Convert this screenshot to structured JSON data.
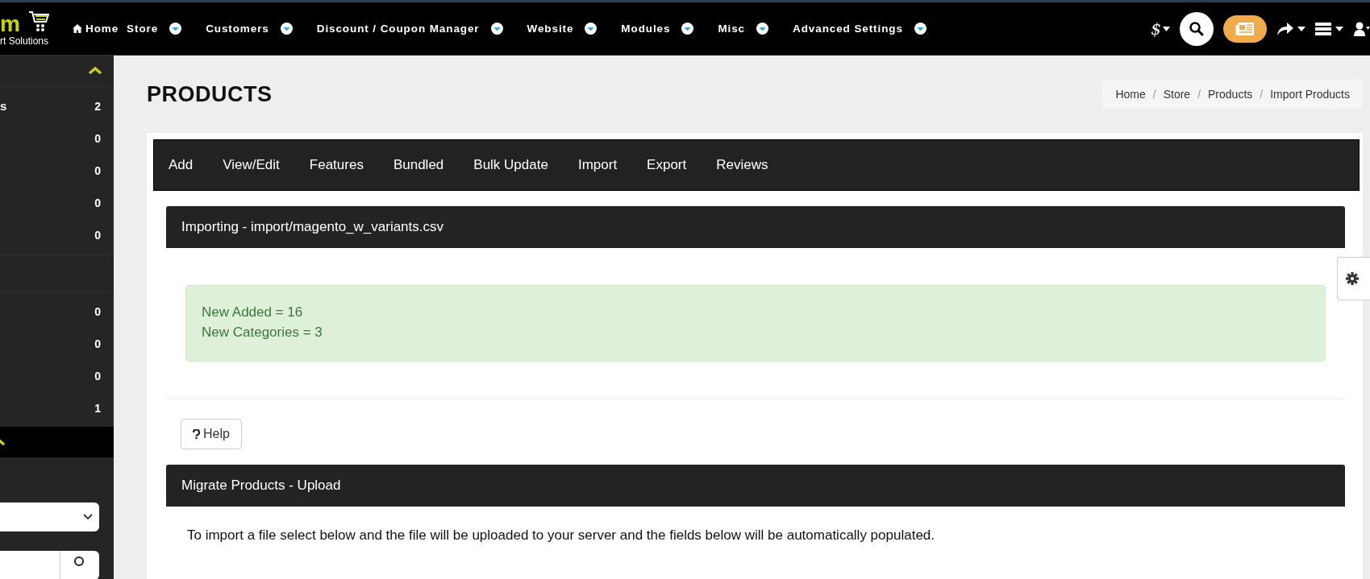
{
  "logo": {
    "letter": "m",
    "tagline": "rt Solutions"
  },
  "nav": [
    {
      "label": "Home",
      "kind": "home",
      "dropdown": false
    },
    {
      "label": "Store",
      "kind": "menu",
      "dropdown": true
    },
    {
      "label": "Customers",
      "kind": "menu",
      "dropdown": true
    },
    {
      "label": "Discount / Coupon Manager",
      "kind": "menu",
      "dropdown": true
    },
    {
      "label": "Website",
      "kind": "menu",
      "dropdown": true
    },
    {
      "label": "Modules",
      "kind": "menu",
      "dropdown": true
    },
    {
      "label": "Misc",
      "kind": "menu",
      "dropdown": true
    },
    {
      "label": "Advanced Settings",
      "kind": "menu",
      "dropdown": true
    }
  ],
  "nav_right": {
    "currency": "$"
  },
  "sidebar": {
    "groups": [
      {
        "items": [
          {
            "label": "s",
            "count": "2"
          },
          {
            "count": "0"
          },
          {
            "count": "0"
          },
          {
            "count": "0"
          },
          {
            "count": "0"
          }
        ]
      },
      {
        "items": [
          {
            "count": "0"
          },
          {
            "count": "0"
          },
          {
            "count": "0"
          },
          {
            "count": "1"
          }
        ]
      }
    ]
  },
  "page_title": "PRODUCTS",
  "breadcrumb": [
    "Home",
    "Store",
    "Products",
    "Import Products"
  ],
  "breadcrumb_separator": "/",
  "tabs": [
    {
      "label": "Add"
    },
    {
      "label": "View/Edit"
    },
    {
      "label": "Features"
    },
    {
      "label": "Bundled"
    },
    {
      "label": "Bulk Update"
    },
    {
      "label": "Import"
    },
    {
      "label": "Export"
    },
    {
      "label": "Reviews"
    }
  ],
  "import_panel": {
    "title": "Importing - import/magento_w_variants.csv",
    "messages": [
      "New Added = 16",
      "New Categories = 3"
    ]
  },
  "help_button": {
    "label": "Help"
  },
  "upload_panel": {
    "title": "Migrate Products - Upload",
    "text": "To import a file select below and the file will be uploaded to your server and the fields below will be automatically populated."
  }
}
